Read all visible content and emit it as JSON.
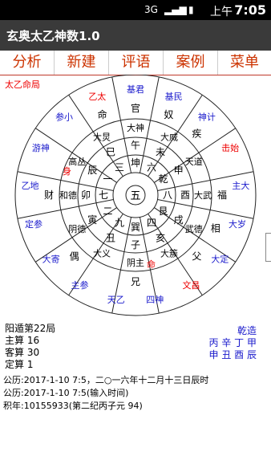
{
  "status": {
    "icons": [
      "3g-icon",
      "signal-icon",
      "battery-icon"
    ],
    "ampm": "上午",
    "time": "7:05"
  },
  "app_title": "玄奥太乙神数1.0",
  "menu": [
    "分析",
    "新建",
    "评语",
    "案例",
    "菜单"
  ],
  "chart_label": "太乙命局",
  "chart": {
    "outer_ring": [
      {
        "text": "基君",
        "color": "blue"
      },
      {
        "text": "基民",
        "color": "blue"
      },
      {
        "text": "神计",
        "color": "blue"
      },
      {
        "text": "击始",
        "color": "red"
      },
      {
        "text": "主大",
        "color": "blue"
      },
      {
        "text": "大岁",
        "color": "blue"
      },
      {
        "text": "大定",
        "color": "blue"
      },
      {
        "text": "文昌",
        "color": "red"
      },
      {
        "text": "四神",
        "color": "blue"
      },
      {
        "text": "天乙",
        "color": "blue"
      },
      {
        "text": "主参",
        "color": "blue"
      },
      {
        "text": "大寄",
        "color": "blue"
      },
      {
        "text": "定参",
        "color": "blue"
      },
      {
        "text": "乙地",
        "color": "blue"
      },
      {
        "text": "游神",
        "color": "blue"
      },
      {
        "text": "参小",
        "color": "blue"
      },
      {
        "text": "乙太",
        "color": "red"
      }
    ],
    "ring4": [
      "官",
      "奴",
      "疾",
      "",
      "福",
      "相",
      "父",
      "",
      "兄",
      "",
      "偶",
      "",
      "财",
      "",
      "",
      "命"
    ],
    "ring3": [
      "大神",
      "大威",
      "天道",
      "大武",
      "武德",
      "大簇",
      "阴主",
      "大义",
      "阴德",
      "和德",
      "高丛",
      "大炅"
    ],
    "ring2": [
      "午",
      "未",
      "申",
      "酉",
      "戌",
      "亥",
      "子",
      "丑",
      "寅",
      "卯",
      "辰",
      "巳"
    ],
    "ring2b": [
      "坤",
      "六",
      "乾",
      "八",
      "艮",
      "四",
      "巽",
      "九",
      "二",
      "七",
      "一",
      "三"
    ],
    "center": [
      "五"
    ],
    "marks": {
      "身": "身",
      "命": "命"
    }
  },
  "info_left": [
    "阳遁第22局",
    "主算 16",
    "客算 30",
    "定算 1"
  ],
  "info_right": {
    "title": "乾造",
    "line1": "丙 辛 丁 甲",
    "line2": "申 丑 酉 辰"
  },
  "footer": [
    "公历:2017-1-10 7:5，二○一六年十二月十三日辰时",
    "公历:2017-1-10 7:5(输入时间)",
    "积年:10155933(第二纪丙子元 94)"
  ],
  "colors": {
    "accent": "#cc3300",
    "title_bg": "#3a3a3a",
    "red": "#ee0000",
    "blue": "#1a1acc"
  }
}
